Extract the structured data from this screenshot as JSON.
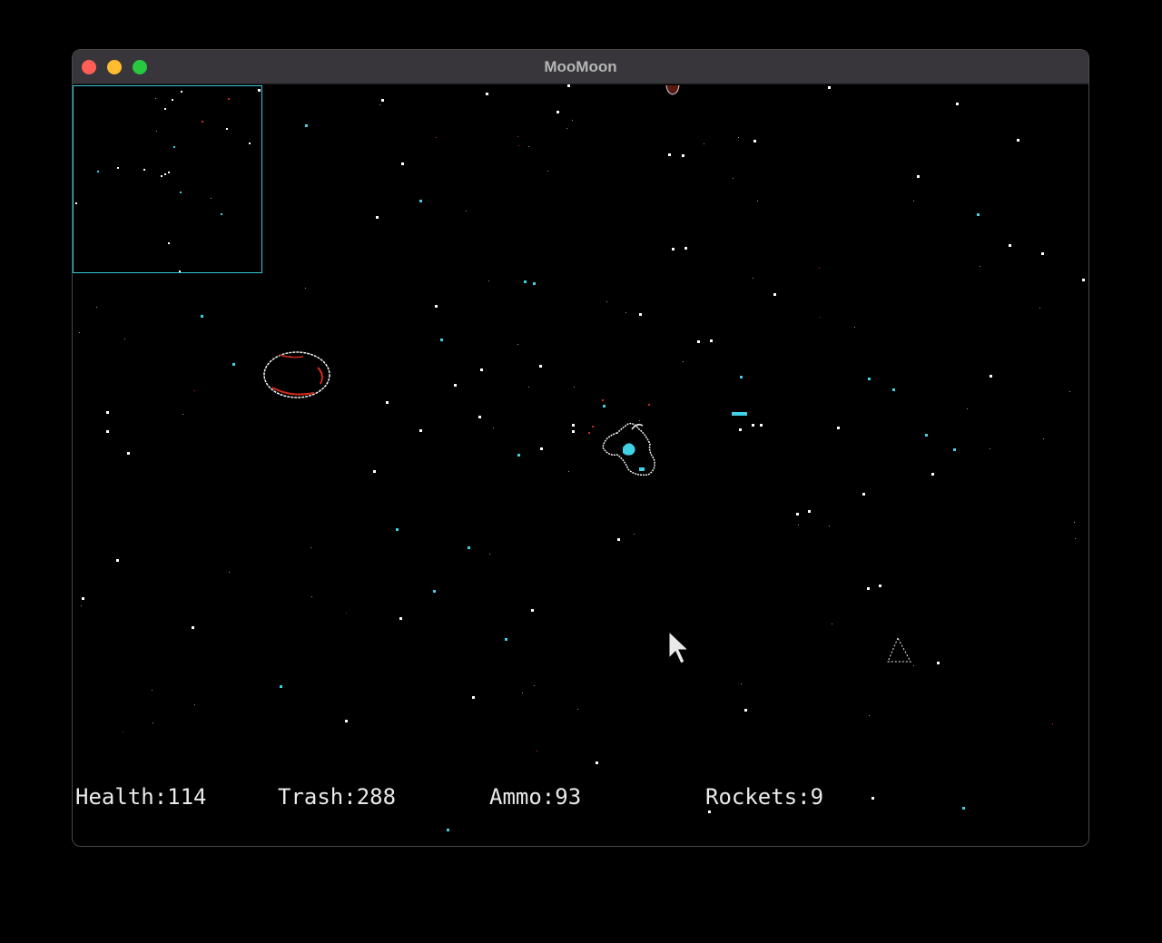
{
  "window": {
    "title": "MooMoon"
  },
  "hud": {
    "health": {
      "label": "Health:",
      "value": "114"
    },
    "trash": {
      "label": "Trash:",
      "value": "288"
    },
    "ammo": {
      "label": "Ammo:",
      "value": "93"
    },
    "rockets": {
      "label": "Rockets:",
      "value": "9"
    }
  },
  "colors": {
    "background": "#000000",
    "minimap_border": "#35c6d8",
    "star_white": "#ffffff",
    "star_cyan": "#3fd2e6",
    "debris_red": "#d12a1a",
    "hud_text": "#eaeaea"
  },
  "icons": {
    "cursor": "arrow-cursor-icon",
    "player": "cow-ship-icon",
    "asteroid": "asteroid-icon",
    "enemy": "space-debris-icon"
  }
}
